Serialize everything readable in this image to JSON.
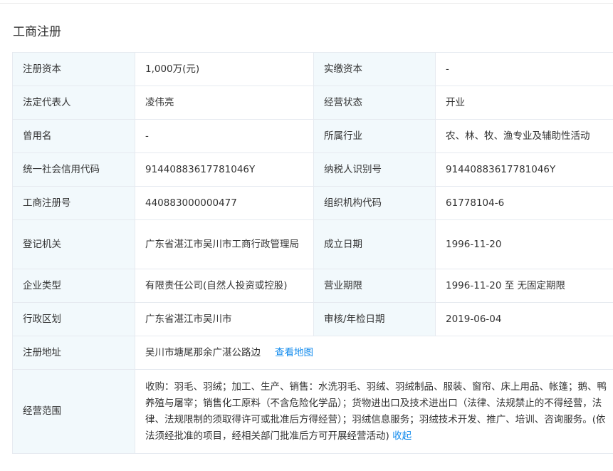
{
  "section_title": "工商注册",
  "rows": [
    {
      "k1": "注册资本",
      "v1": "1,000万(元)",
      "k2": "实缴资本",
      "v2": "-"
    },
    {
      "k1": "法定代表人",
      "v1": "凌伟亮",
      "k2": "经营状态",
      "v2": "开业"
    },
    {
      "k1": "曾用名",
      "v1": "-",
      "k2": "所属行业",
      "v2": "农、林、牧、渔专业及辅助性活动"
    },
    {
      "k1": "统一社会信用代码",
      "v1": "914408836177810 46Y",
      "k2": "纳税人识别号",
      "v2": "91440883617781046Y"
    },
    {
      "k1": "工商注册号",
      "v1": "440883000000477",
      "k2": "组织机构代码",
      "v2": "61778104-6"
    },
    {
      "k1": "登记机关",
      "v1": "广东省湛江市吴川市工商行政管理局",
      "k2": "成立日期",
      "v2": "1996-11-20"
    },
    {
      "k1": "企业类型",
      "v1": "有限责任公司(自然人投资或控股)",
      "k2": "营业期限",
      "v2": "1996-11-20 至 无固定期限"
    },
    {
      "k1": "行政区划",
      "v1": "广东省湛江市吴川市",
      "k2": "审核/年检日期",
      "v2": "2019-06-04"
    }
  ],
  "address": {
    "label": "注册地址",
    "value": "吴川市塘尾那余广湛公路边",
    "link": "查看地图"
  },
  "scope": {
    "label": "经营范围",
    "value": "收购：羽毛、羽绒；加工、生产、销售：水洗羽毛、羽绒、羽绒制品、服装、窗帘、床上用品、帐篷；鹅、鸭养殖与屠宰；销售化工原料（不含危险化学品）；货物进出口及技术进出口（法律、法规禁止的不得经营，法律、法规限制的须取得许可或批准后方得经营）；羽绒信息服务；羽绒技术开发、推广、培训、咨询服务。(依法须经批准的项目，经相关部门批准后方可开展经营活动)",
    "link": "收起"
  }
}
